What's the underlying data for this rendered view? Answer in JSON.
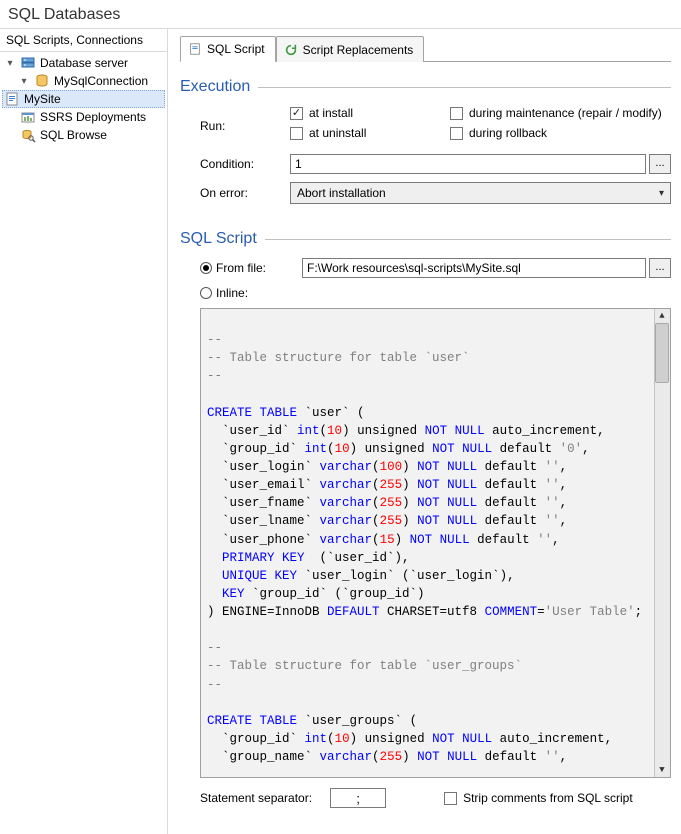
{
  "title": "SQL Databases",
  "sidebar": {
    "title": "SQL Scripts, Connections",
    "nodes": {
      "server": "Database server",
      "connection": "MySqlConnection",
      "script": "MySite",
      "ssrs": "SSRS Deployments",
      "browse": "SQL Browse"
    }
  },
  "tabs": {
    "script": "SQL Script",
    "replacements": "Script Replacements"
  },
  "execution": {
    "heading": "Execution",
    "runLabel": "Run:",
    "checks": {
      "atInstall": "at install",
      "duringMaintenance": "during maintenance (repair / modify)",
      "atUninstall": "at uninstall",
      "duringRollback": "during rollback"
    },
    "conditionLabel": "Condition:",
    "conditionValue": "1",
    "onErrorLabel": "On error:",
    "onErrorValue": "Abort installation"
  },
  "sqlScript": {
    "heading": "SQL Script",
    "fromFileLabel": "From file:",
    "fromFileValue": "F:\\Work resources\\sql-scripts\\MySite.sql",
    "inlineLabel": "Inline:"
  },
  "footer": {
    "separatorLabel": "Statement separator:",
    "separatorValue": ";",
    "stripLabel": "Strip comments from SQL script"
  },
  "sql": {
    "l01": "--",
    "l02a": "-- Table structure for table ",
    "l02b": "`user`",
    "l03": "--",
    "l05a": "CREATE TABLE ",
    "l05b": "`user`",
    "l05c": " (",
    "l06a": "  `user_id` ",
    "l06b": "int",
    "l06c": "(",
    "l06d": "10",
    "l06e": ") unsigned ",
    "l06f": "NOT NULL",
    "l06g": " auto_increment,",
    "l07a": "  `group_id` ",
    "l07b": "int",
    "l07c": "(",
    "l07d": "10",
    "l07e": ") unsigned ",
    "l07f": "NOT NULL",
    "l07g": " default ",
    "l07h": "'0'",
    "l07i": ",",
    "l08a": "  `user_login` ",
    "l08b": "varchar",
    "l08c": "(",
    "l08d": "100",
    "l08e": ") ",
    "l08f": "NOT NULL",
    "l08g": " default ",
    "l08h": "''",
    "l08i": ",",
    "l09a": "  `user_email` ",
    "l09b": "varchar",
    "l09c": "(",
    "l09d": "255",
    "l09e": ") ",
    "l09f": "NOT NULL",
    "l09g": " default ",
    "l09h": "''",
    "l09i": ",",
    "l10a": "  `user_fname` ",
    "l10b": "varchar",
    "l10c": "(",
    "l10d": "255",
    "l10e": ") ",
    "l10f": "NOT NULL",
    "l10g": " default ",
    "l10h": "''",
    "l10i": ",",
    "l11a": "  `user_lname` ",
    "l11b": "varchar",
    "l11c": "(",
    "l11d": "255",
    "l11e": ") ",
    "l11f": "NOT NULL",
    "l11g": " default ",
    "l11h": "''",
    "l11i": ",",
    "l12a": "  `user_phone` ",
    "l12b": "varchar",
    "l12c": "(",
    "l12d": "15",
    "l12e": ") ",
    "l12f": "NOT NULL",
    "l12g": " default ",
    "l12h": "''",
    "l12i": ",",
    "l13a": "  ",
    "l13b": "PRIMARY KEY",
    "l13c": "  (`user_id`),",
    "l14a": "  ",
    "l14b": "UNIQUE KEY",
    "l14c": " `user_login` (`user_login`),",
    "l15a": "  ",
    "l15b": "KEY",
    "l15c": " `group_id` (`group_id`)",
    "l16a": ") ENGINE=InnoDB ",
    "l16b": "DEFAULT",
    "l16c": " CHARSET=utf8 ",
    "l16d": "COMMENT",
    "l16e": "=",
    "l16f": "'User Table'",
    "l16g": ";",
    "l18": "--",
    "l19a": "-- Table structure for table ",
    "l19b": "`user_groups`",
    "l20": "--",
    "l22a": "CREATE TABLE ",
    "l22b": "`user_groups`",
    "l22c": " (",
    "l23a": "  `group_id` ",
    "l23b": "int",
    "l23c": "(",
    "l23d": "10",
    "l23e": ") unsigned ",
    "l23f": "NOT NULL",
    "l23g": " auto_increment,",
    "l24a": "  `group_name` ",
    "l24b": "varchar",
    "l24c": "(",
    "l24d": "255",
    "l24e": ") ",
    "l24f": "NOT NULL",
    "l24g": " default ",
    "l24h": "''",
    "l24i": ","
  }
}
